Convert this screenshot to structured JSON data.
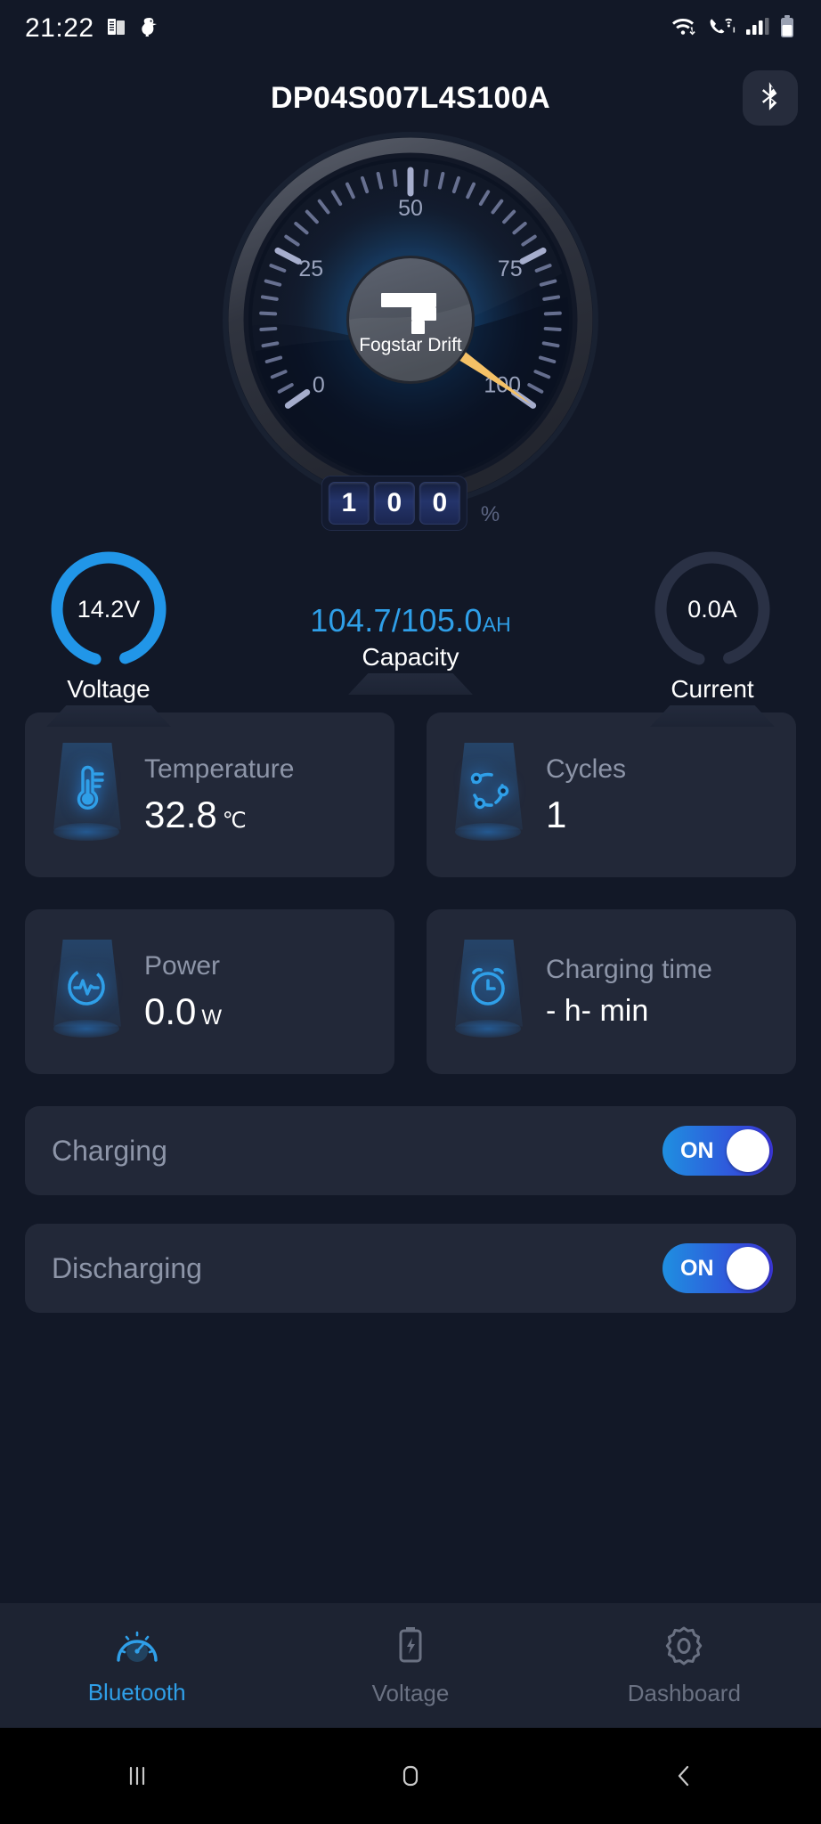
{
  "status_bar": {
    "time": "21:22",
    "left_icons": [
      "news-icon",
      "duck-icon"
    ],
    "right_icons": [
      "wifi-data-icon",
      "wifi-calling-icon",
      "signal-bars-icon",
      "battery-icon"
    ]
  },
  "header": {
    "title": "DP04S007L4S100A",
    "bluetooth_button": "bluetooth-icon"
  },
  "gauge": {
    "brand": "Fogstar Drift",
    "value_digits": [
      "1",
      "0",
      "0"
    ],
    "percent_symbol": "%",
    "tick_labels": [
      "0",
      "25",
      "50",
      "75",
      "100"
    ],
    "needle_color": "#f5c166",
    "min": 0,
    "max": 100,
    "value": 100
  },
  "stats": {
    "voltage": {
      "value": "14.2V",
      "label": "Voltage",
      "ring_color": "#2196e8",
      "active": true
    },
    "capacity": {
      "value": "104.7/105.0",
      "unit": "AH",
      "label": "Capacity",
      "color": "#2f9fe8"
    },
    "current": {
      "value": "0.0A",
      "label": "Current",
      "ring_color": "#2a3145",
      "active": false
    }
  },
  "metrics": [
    {
      "icon": "thermometer-icon",
      "title": "Temperature",
      "value": "32.8",
      "unit": "℃"
    },
    {
      "icon": "cycle-icon",
      "title": "Cycles",
      "value": "1",
      "unit": ""
    },
    {
      "icon": "power-pulse-icon",
      "title": "Power",
      "value": "0.0",
      "unit": "W"
    },
    {
      "icon": "alarm-clock-icon",
      "title": "Charging time",
      "value": "- h- min",
      "unit": ""
    }
  ],
  "switches": [
    {
      "label": "Charging",
      "state": "ON"
    },
    {
      "label": "Discharging",
      "state": "ON"
    }
  ],
  "bottom_nav": [
    {
      "icon": "speedometer-icon",
      "label": "Bluetooth",
      "active": true
    },
    {
      "icon": "battery-bolt-icon",
      "label": "Voltage",
      "active": false
    },
    {
      "icon": "gear-icon",
      "label": "Dashboard",
      "active": false
    }
  ],
  "android_nav": [
    "recents-icon",
    "home-icon",
    "back-icon"
  ]
}
